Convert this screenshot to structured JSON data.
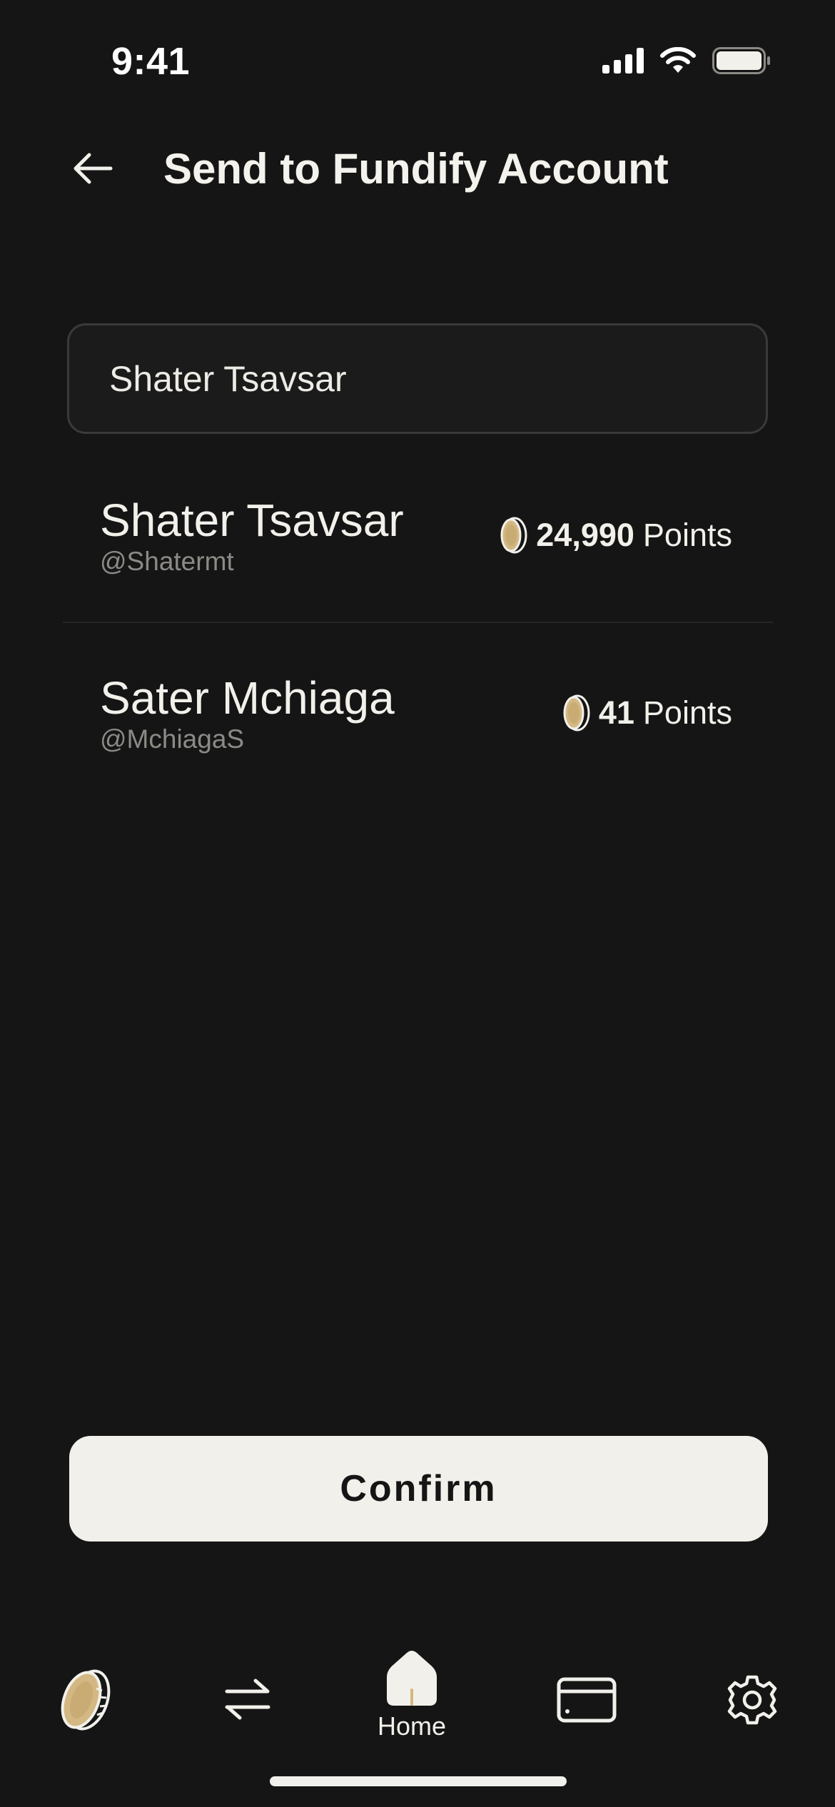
{
  "status_bar": {
    "time": "9:41",
    "icons": [
      "cellular-signal-icon",
      "wifi-icon",
      "battery-icon"
    ]
  },
  "header": {
    "title": "Send to Fundify Account",
    "back_icon": "arrow-left-icon"
  },
  "search": {
    "value": "Shater Tsavsar",
    "placeholder": ""
  },
  "results": [
    {
      "name": "Shater Tsavsar",
      "handle": "@Shatermt",
      "points": "24,990",
      "unit": "Points"
    },
    {
      "name": "Sater Mchiaga",
      "handle": "@MchiagaS",
      "points": "41",
      "unit": "Points"
    }
  ],
  "confirm_label": "Confirm",
  "nav": {
    "items": [
      {
        "icon": "coin-icon"
      },
      {
        "icon": "transfer-arrows-icon"
      },
      {
        "icon": "home-icon",
        "label": "Home"
      },
      {
        "icon": "card-icon"
      },
      {
        "icon": "gear-icon"
      }
    ]
  },
  "colors": {
    "background": "#151515",
    "text": "#F2F0EA",
    "muted": "#8C8A86",
    "coin": "#D4B883"
  }
}
